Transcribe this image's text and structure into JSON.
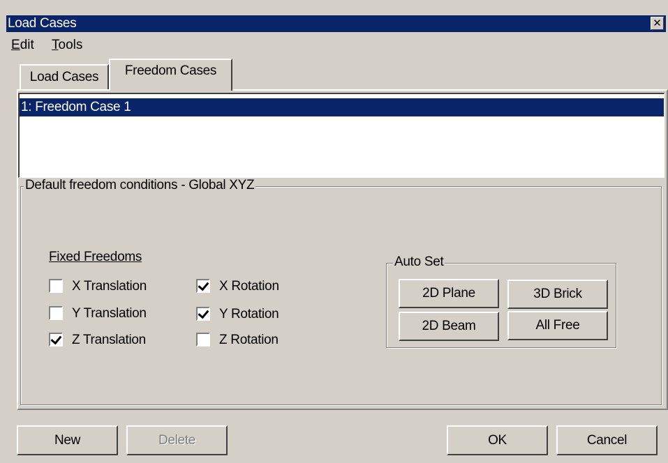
{
  "window": {
    "title": "Load Cases",
    "close_glyph": "✕"
  },
  "menu": [
    {
      "mnemonic": "E",
      "rest": "dit"
    },
    {
      "mnemonic": "T",
      "rest": "ools"
    }
  ],
  "tabs": [
    {
      "label": "Load Cases",
      "active": false
    },
    {
      "label": "Freedom Cases",
      "active": true
    }
  ],
  "list": {
    "items": [
      {
        "label": "1: Freedom Case 1",
        "selected": true
      }
    ]
  },
  "defaults_group": {
    "title": "Default freedom conditions - Global XYZ",
    "fixed_label": "Fixed Freedoms",
    "checkboxes": [
      {
        "label": "X Translation",
        "checked": false
      },
      {
        "label": "Y Translation",
        "checked": false
      },
      {
        "label": "Z Translation",
        "checked": true
      },
      {
        "label": "X Rotation",
        "checked": true
      },
      {
        "label": "Y Rotation",
        "checked": true
      },
      {
        "label": "Z Rotation",
        "checked": false
      }
    ]
  },
  "auto_set": {
    "title": "Auto Set",
    "buttons": [
      "2D Plane",
      "3D Brick",
      "2D Beam",
      "All Free"
    ]
  },
  "footer": {
    "new_label": "New",
    "delete_label": "Delete",
    "ok_label": "OK",
    "cancel_label": "Cancel"
  },
  "colors": {
    "titlebar": "#0a246a",
    "face": "#d4d0c8",
    "selection": "#0a246a"
  }
}
